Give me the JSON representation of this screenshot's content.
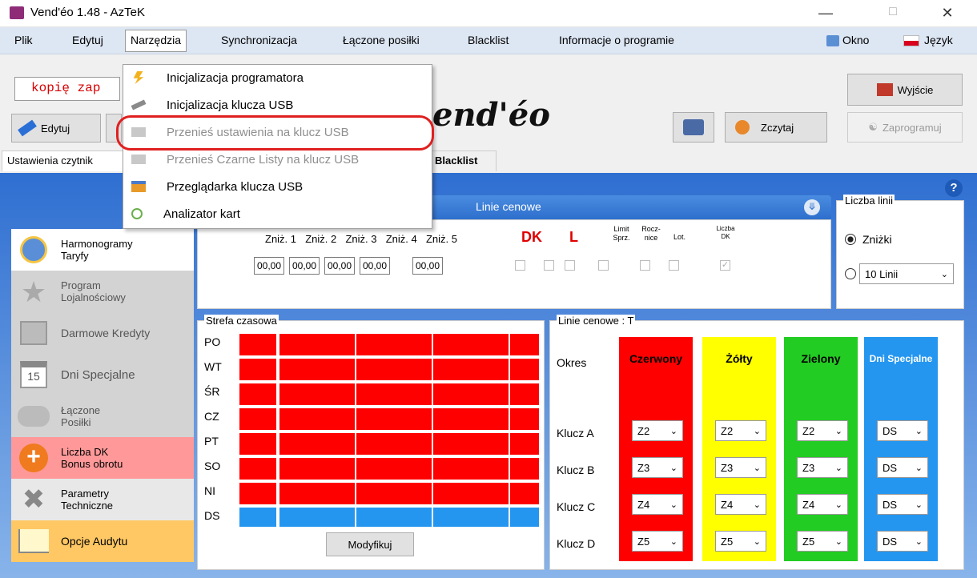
{
  "window": {
    "title": "Vend'éo 1.48 - AzTeK"
  },
  "menu": {
    "items": [
      "Plik",
      "Edytuj",
      "Narzędzia",
      "Synchronizacja",
      "Łączone posiłki",
      "Blacklist",
      "Informacje o programie"
    ],
    "right": {
      "okno": "Okno",
      "jezyk": "Język"
    }
  },
  "dropdown": {
    "items": [
      {
        "label": "Inicjalizacja programatora",
        "enabled": true
      },
      {
        "label": "Inicjalizacja klucza USB",
        "enabled": true
      },
      {
        "label": "Przenieś ustawienia na klucz USB",
        "enabled": false
      },
      {
        "label": "Przenieś Czarne Listy na klucz USB",
        "enabled": false
      },
      {
        "label": "Przeglądarka klucza USB",
        "enabled": true
      },
      {
        "label": "Analizator kart",
        "enabled": true
      }
    ]
  },
  "toolbar": {
    "backup_text": "kopię zap",
    "edit": "Edytuj",
    "logo": "end'éo",
    "read": "Zczytaj",
    "exit": "Wyjście",
    "program": "Zaprogramuj"
  },
  "tabs": [
    "Ustawienia czytnik",
    "Blacklist"
  ],
  "sidebar": [
    {
      "line1": "Harmonogramy",
      "line2": "Taryfy"
    },
    {
      "line1": "Program",
      "line2": "Lojalnościowy"
    },
    {
      "line1": "Darmowe Kredyty",
      "line2": ""
    },
    {
      "line1": "Dni Specjalne",
      "line2": "",
      "badge": "15"
    },
    {
      "line1": "Łączone",
      "line2": "Posiłki"
    },
    {
      "line1": "Liczba DK",
      "line2": "Bonus obrotu"
    },
    {
      "line1": "Parametry",
      "line2": "Techniczne"
    },
    {
      "line1": "Opcje Audytu",
      "line2": ""
    }
  ],
  "price_lines": {
    "header": "Linie cenowe",
    "discounts": [
      "Zniż. 1",
      "Zniż. 2",
      "Zniż. 3",
      "Zniż. 4",
      "Zniż. 5"
    ],
    "dk": "DK",
    "l": "L",
    "limit": "Limit Sprz.",
    "rocz": "Rocz- nice",
    "lot": "Lot.",
    "liczba_dk": "Liczba DK",
    "values": [
      "00,00",
      "00,00",
      "00,00",
      "00,00",
      "00,00"
    ]
  },
  "lines_count": {
    "label": "Liczba linii",
    "opt1": "Zniżki",
    "opt2": "10 Linii"
  },
  "time_zone": {
    "label": "Strefa czasowa",
    "days": [
      "PO",
      "WT",
      "ŚR",
      "CZ",
      "PT",
      "SO",
      "NI",
      "DS"
    ],
    "modify": "Modyfikuj"
  },
  "tariff": {
    "label": "Linie cenowe : T",
    "period": "Okres",
    "cols": [
      "Czerwony",
      "Żółty",
      "Zielony",
      "Dni Specjalne"
    ],
    "keys": [
      "Klucz A",
      "Klucz B",
      "Klucz C",
      "Klucz D"
    ],
    "values": [
      [
        "Z2",
        "Z2",
        "Z2",
        "DS"
      ],
      [
        "Z3",
        "Z3",
        "Z3",
        "DS"
      ],
      [
        "Z4",
        "Z4",
        "Z4",
        "DS"
      ],
      [
        "Z5",
        "Z5",
        "Z5",
        "DS"
      ]
    ],
    "colors": [
      "#ff0000",
      "#ffff00",
      "#22cc22",
      "#2496f0"
    ]
  }
}
